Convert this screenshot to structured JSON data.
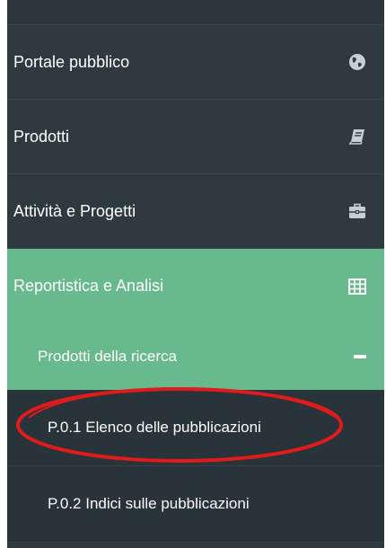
{
  "nav": {
    "items": [
      {
        "label": "Portale pubblico",
        "icon": "globe-icon"
      },
      {
        "label": "Prodotti",
        "icon": "book-icon"
      },
      {
        "label": "Attività e Progetti",
        "icon": "briefcase-icon"
      },
      {
        "label": "Reportistica e Analisi",
        "icon": "table-icon"
      }
    ]
  },
  "submenu": {
    "header": {
      "label": "Prodotti della ricerca",
      "icon": "minus-icon"
    },
    "items": [
      {
        "label": "P.0.1 Elenco delle pubblicazioni",
        "highlighted": true
      },
      {
        "label": "P.0.2 Indici sulle pubblicazioni"
      }
    ]
  },
  "colors": {
    "sidebar_bg": "#2f3a40",
    "active_bg": "#68b98d",
    "submenu_bg": "#28333a",
    "annotation": "#e01b1b"
  }
}
